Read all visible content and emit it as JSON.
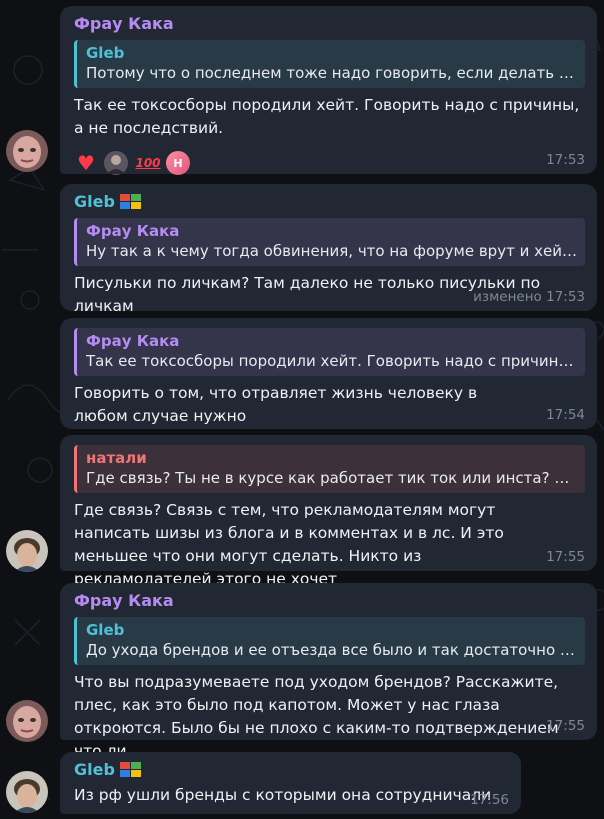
{
  "colors": {
    "background": "#0e1014",
    "bubble": "#222833",
    "purple_name": "#b58cf2",
    "teal_name": "#4fc1d6",
    "red_name": "#f17574",
    "time": "#7f8792"
  },
  "messages": [
    {
      "sender": "Фрау Кака",
      "reply_name": "Gleb",
      "reply_text": "Потому что о последнем тоже надо говорить, если делать в...",
      "text": "Так ее токсосборы породили хейт. Говорить надо с причины, а не последствий.",
      "reactions": {
        "heart": "♥",
        "hundred": "100",
        "letter": "H"
      },
      "time": "17:53"
    },
    {
      "sender": "Gleb",
      "reply_name": "Фрау Кака",
      "reply_text": "Ну так а к чему тогда обвинения, что на форуме врут и хейтя...",
      "text": "Писульки по личкам? Там далеко не только писульки по личкам",
      "time": "изменено 17:53"
    },
    {
      "reply_name": "Фрау Кака",
      "reply_text": "Так ее токсосборы породили хейт. Говорить надо с причины...",
      "text": "Говорить о том, что отравляет жизнь человеку в любом случае нужно",
      "time": "17:54"
    },
    {
      "reply_name": "натали",
      "reply_text": "Где связь? Ты не в курсе как работает тик ток или инста?  В тт...",
      "text": "Где связь? Связь с тем, что рекламодателям могут написать шизы из блога и в комментах и в лс. И это меньшее что они могут сделать. Никто из рекламодателей этого не хочет",
      "time": "17:55"
    },
    {
      "sender": "Фрау Кака",
      "reply_name": "Gleb",
      "reply_text": "До ухода брендов и ее отъезда все было и так достаточно р...",
      "text": "Что вы подразумеваете под уходом брендов? Расскажите, плес, как это было под капотом. Может у нас глаза откроются. Было бы не плохо с каким-то подтверждением что ли.",
      "time": "17:55"
    },
    {
      "sender": "Gleb",
      "text": "Из рф ушли бренды с которыми она сотрудничали",
      "time": "17:56"
    }
  ]
}
